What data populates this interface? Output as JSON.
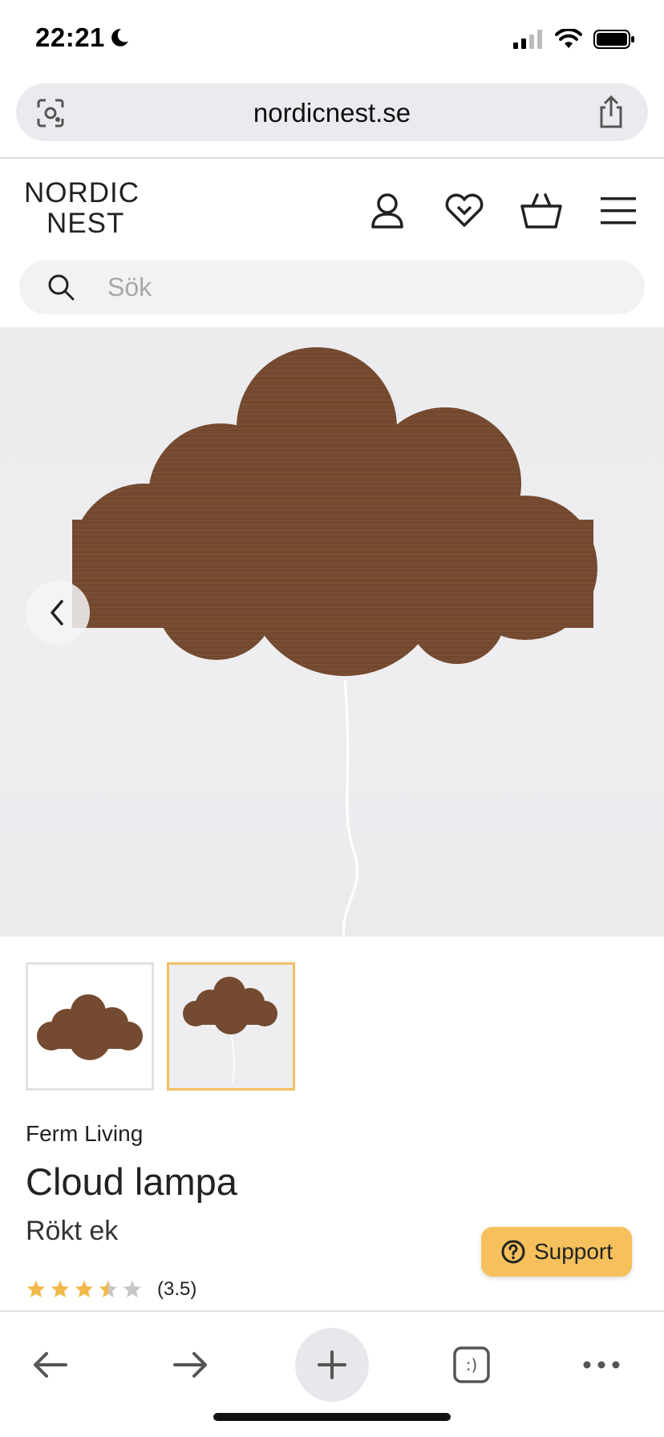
{
  "status_bar": {
    "time": "22:21",
    "icons": [
      "moon-icon",
      "signal-icon",
      "wifi-icon",
      "battery-icon"
    ]
  },
  "address_bar": {
    "url": "nordicnest.se",
    "icons": [
      "lens-icon",
      "share-icon"
    ]
  },
  "header": {
    "logo_line1": "NORDIC",
    "logo_line2": "NEST",
    "icons": [
      "account-icon",
      "wishlist-icon",
      "basket-icon",
      "menu-icon"
    ]
  },
  "search": {
    "placeholder": "Sök"
  },
  "gallery": {
    "image_count": 2,
    "active_index": 1
  },
  "product": {
    "brand": "Ferm Living",
    "title": "Cloud lampa",
    "variant": "Rökt ek",
    "rating": 3.5,
    "rating_max": 5,
    "rating_label": "(3.5)"
  },
  "support": {
    "label": "Support"
  },
  "toolbar": {
    "icons": [
      "back-icon",
      "forward-icon",
      "new-tab-icon",
      "tabs-icon",
      "more-icon"
    ],
    "tabs_label": ":)"
  },
  "colors": {
    "accent": "#f6c15c",
    "star_filled": "#f2b84b",
    "star_empty": "#c8c8c8",
    "wood": "#7a4f33"
  }
}
